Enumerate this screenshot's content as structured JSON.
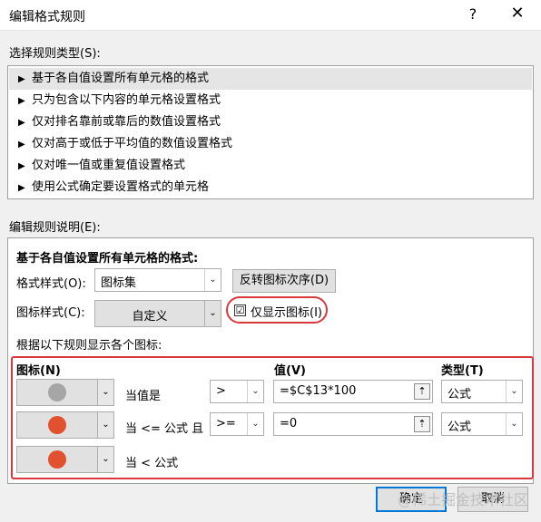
{
  "dialog": {
    "title": "编辑格式规则",
    "help": "?",
    "close": "✕"
  },
  "rule_types": {
    "label": "选择规则类型(S):",
    "items": [
      "基于各自值设置所有单元格的格式",
      "只为包含以下内容的单元格设置格式",
      "仅对排名靠前或靠后的数值设置格式",
      "仅对高于或低于平均值的数值设置格式",
      "仅对唯一值或重复值设置格式",
      "使用公式确定要设置格式的单元格"
    ],
    "bullet": "▶"
  },
  "description": {
    "label": "编辑规则说明(E):",
    "heading": "基于各自值设置所有单元格的格式:",
    "format_style_label": "格式样式(O):",
    "format_style_value": "图标集",
    "reverse_button": "反转图标次序(D)",
    "icon_style_label": "图标样式(C):",
    "icon_style_value": "自定义",
    "show_icon_only_label": "仅显示图标(I)",
    "show_icon_only_checked": "☑",
    "rules_caption": "根据以下规则显示各个图标:",
    "col_icon": "图标(N)",
    "col_value": "值(V)",
    "col_type": "类型(T)",
    "rows": [
      {
        "icon_color": "#a6a6a6",
        "condition": "当值是",
        "operator": ">",
        "value": "=$C$13*100",
        "type": "公式"
      },
      {
        "icon_color": "#e2512f",
        "condition": "当 <= 公式 且",
        "operator": ">=",
        "value": "=0",
        "type": "公式"
      },
      {
        "icon_color": "#e2512f",
        "condition": "当 < 公式"
      }
    ]
  },
  "buttons": {
    "ok": "确定",
    "cancel": "取消"
  },
  "watermark": "@稀土掘金技术社区",
  "colors": {
    "highlight": "#d9383c",
    "focus": "#0078d7"
  },
  "icons": {
    "dropdown": "⌄",
    "ref": "⇡"
  }
}
